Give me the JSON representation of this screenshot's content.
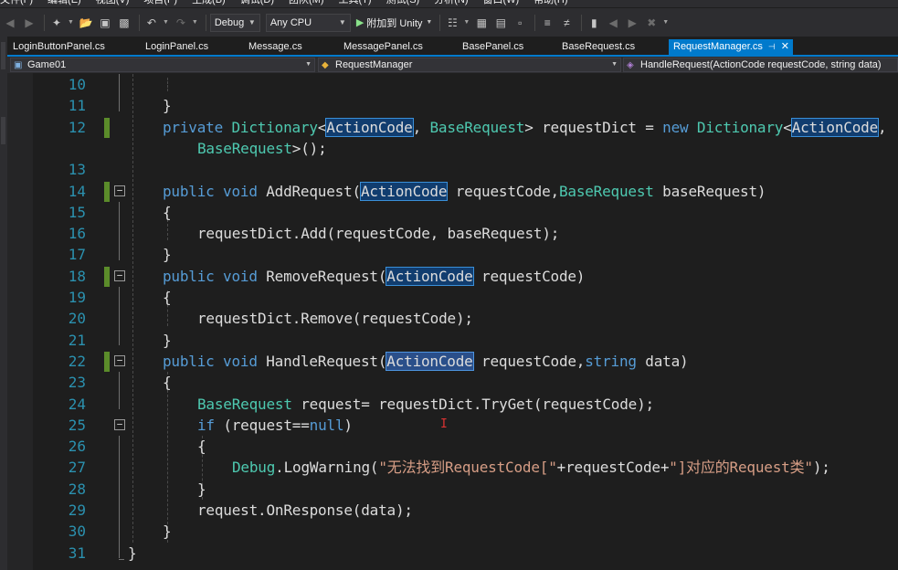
{
  "menu": [
    "文件(F)",
    "编辑(E)",
    "视图(V)",
    "项目(P)",
    "生成(B)",
    "调试(D)",
    "团队(M)",
    "工具(T)",
    "测试(S)",
    "分析(N)",
    "窗口(W)",
    "帮助(H)"
  ],
  "toolbar": {
    "configuration": "Debug",
    "platform": "Any CPU",
    "attach_label": "附加到 Unity"
  },
  "tabs": [
    {
      "label": "LoginButtonPanel.cs",
      "active": false
    },
    {
      "label": "LoginPanel.cs",
      "active": false
    },
    {
      "label": "Message.cs",
      "active": false
    },
    {
      "label": "MessagePanel.cs",
      "active": false
    },
    {
      "label": "BasePanel.cs",
      "active": false
    },
    {
      "label": "BaseRequest.cs",
      "active": false
    },
    {
      "label": "RequestManager.cs",
      "active": true
    }
  ],
  "navbar": {
    "project": "Game01",
    "type": "RequestManager",
    "member": "HandleRequest(ActionCode requestCode, string data)"
  },
  "editor": {
    "line_numbers": [
      "10",
      "11",
      "12",
      "",
      "13",
      "14",
      "15",
      "16",
      "17",
      "18",
      "19",
      "20",
      "21",
      "22",
      "23",
      "24",
      "25",
      "26",
      "27",
      "28",
      "29",
      "30",
      "31"
    ],
    "lines": [
      [],
      [
        [
          "t",
          "}"
        ]
      ],
      [
        [
          "k",
          "private "
        ],
        [
          "y",
          "Dictionary"
        ],
        [
          "t",
          "<"
        ],
        [
          "h",
          "ActionCode"
        ],
        [
          "t",
          ", "
        ],
        [
          "y",
          "BaseRequest"
        ],
        [
          "t",
          "> requestDict = "
        ],
        [
          "k",
          "new "
        ],
        [
          "y",
          "Dictionary"
        ],
        [
          "t",
          "<"
        ],
        [
          "h",
          "ActionCode"
        ],
        [
          "t",
          ","
        ]
      ],
      [
        [
          "y",
          "BaseRequest"
        ],
        [
          "t",
          ">();"
        ]
      ],
      [],
      [
        [
          "k",
          "public "
        ],
        [
          "k",
          "void "
        ],
        [
          "t",
          "AddRequest("
        ],
        [
          "h",
          "ActionCode"
        ],
        [
          "t",
          " requestCode,"
        ],
        [
          "y",
          "BaseRequest"
        ],
        [
          "t",
          " baseRequest)"
        ]
      ],
      [
        [
          "t",
          "{"
        ]
      ],
      [
        [
          "t",
          "requestDict.Add(requestCode, baseRequest);"
        ]
      ],
      [
        [
          "t",
          "}"
        ]
      ],
      [
        [
          "k",
          "public "
        ],
        [
          "k",
          "void "
        ],
        [
          "t",
          "RemoveRequest("
        ],
        [
          "h",
          "ActionCode"
        ],
        [
          "t",
          " requestCode)"
        ]
      ],
      [
        [
          "t",
          "{"
        ]
      ],
      [
        [
          "t",
          "requestDict.Remove(requestCode);"
        ]
      ],
      [
        [
          "t",
          "}"
        ]
      ],
      [
        [
          "k",
          "public "
        ],
        [
          "k",
          "void "
        ],
        [
          "t",
          "HandleRequest("
        ],
        [
          "s",
          "ActionCode"
        ],
        [
          "t",
          " requestCode,"
        ],
        [
          "k",
          "string"
        ],
        [
          "t",
          " data)"
        ]
      ],
      [
        [
          "t",
          "{"
        ]
      ],
      [
        [
          "y",
          "BaseRequest"
        ],
        [
          "t",
          " request= requestDict.TryGet(requestCode);"
        ]
      ],
      [
        [
          "k",
          "if "
        ],
        [
          "t",
          "(request=="
        ],
        [
          "k",
          "null"
        ],
        [
          "t",
          ")"
        ]
      ],
      [
        [
          "t",
          "{"
        ]
      ],
      [
        [
          "y",
          "Debug"
        ],
        [
          "t",
          ".LogWarning("
        ],
        [
          "r",
          "\"无法找到RequestCode[\""
        ],
        [
          "t",
          "+requestCode+"
        ],
        [
          "r",
          "\"]对应的Request类\""
        ],
        [
          "t",
          ");"
        ]
      ],
      [
        [
          "t",
          "}"
        ]
      ],
      [
        [
          "t",
          "request.OnResponse(data);"
        ]
      ],
      [
        [
          "t",
          "}"
        ]
      ],
      [
        [
          "t",
          "}"
        ]
      ]
    ]
  }
}
